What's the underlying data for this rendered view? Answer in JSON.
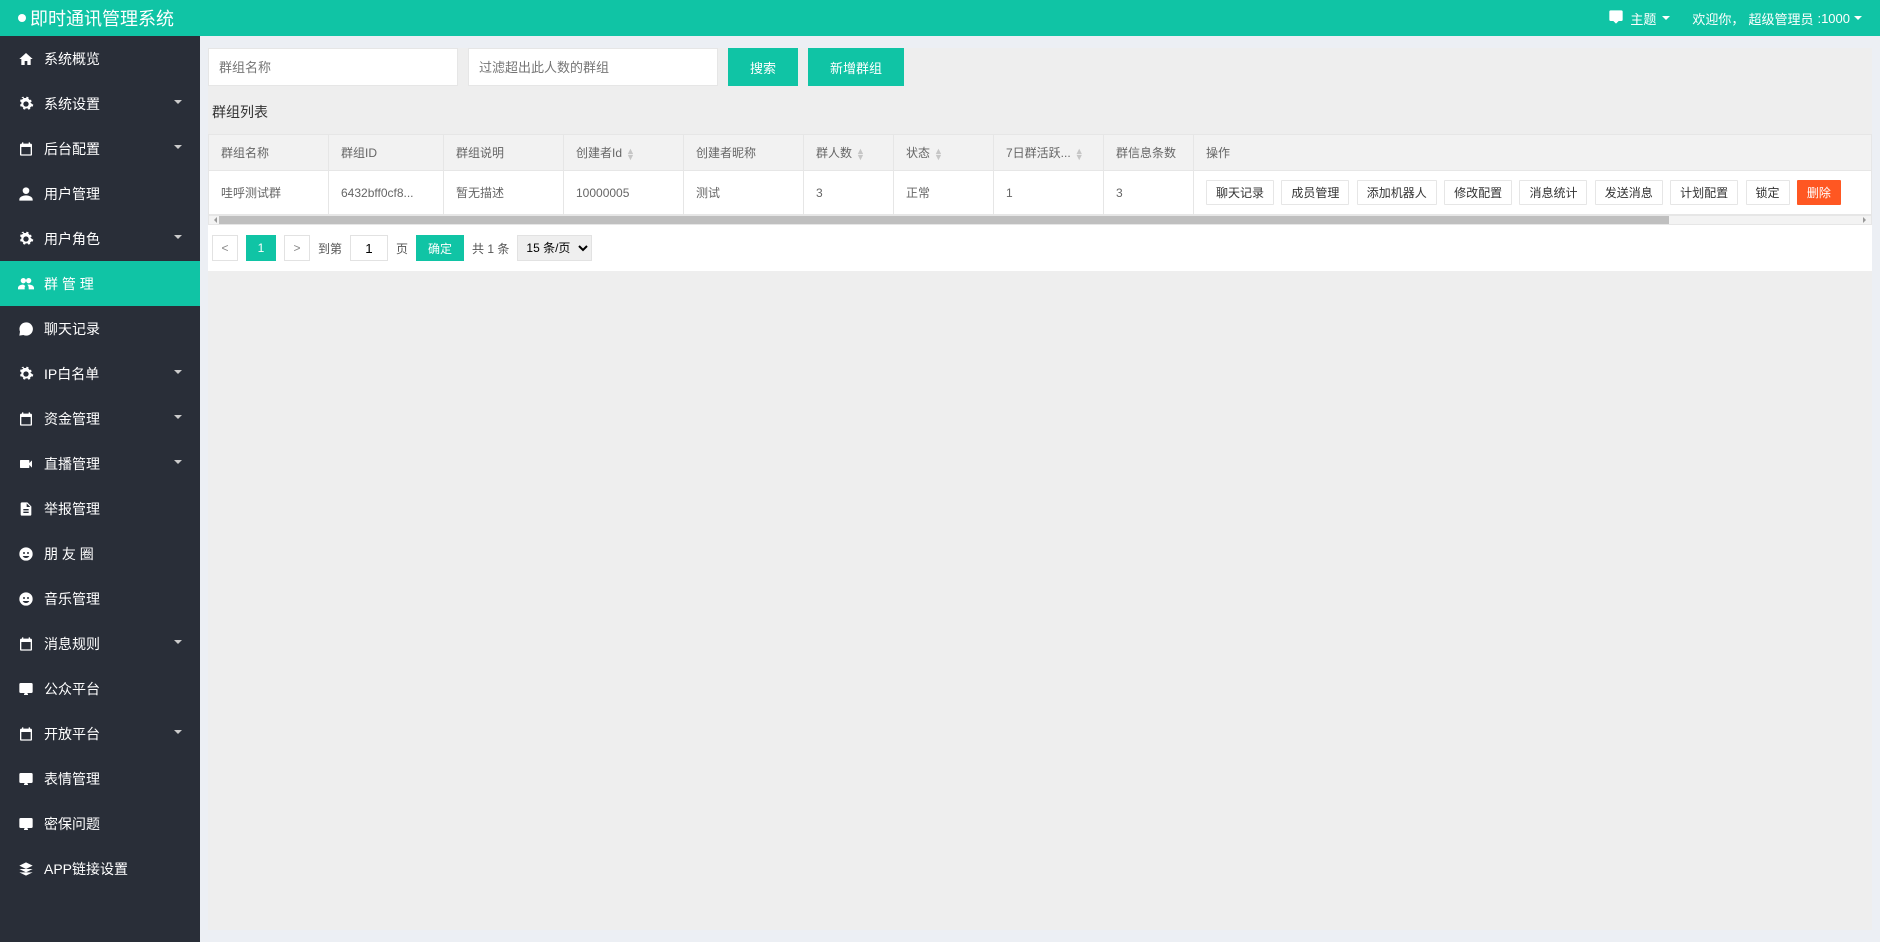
{
  "header": {
    "title": "即时通讯管理系统",
    "theme_label": "主题",
    "welcome_prefix": "欢迎你，",
    "user_role": "超级管理员",
    "user_id": ":1000"
  },
  "sidebar": {
    "items": [
      {
        "icon": "home",
        "label": "系统概览",
        "expandable": false,
        "active": false
      },
      {
        "icon": "gear",
        "label": "系统设置",
        "expandable": true,
        "active": false
      },
      {
        "icon": "calendar",
        "label": "后台配置",
        "expandable": true,
        "active": false
      },
      {
        "icon": "user",
        "label": "用户管理",
        "expandable": false,
        "active": false
      },
      {
        "icon": "gear",
        "label": "用户角色",
        "expandable": true,
        "active": false
      },
      {
        "icon": "users",
        "label": "群 管 理",
        "expandable": false,
        "active": true
      },
      {
        "icon": "chat",
        "label": "聊天记录",
        "expandable": false,
        "active": false
      },
      {
        "icon": "gear",
        "label": "IP白名单",
        "expandable": true,
        "active": false
      },
      {
        "icon": "calendar",
        "label": "资金管理",
        "expandable": true,
        "active": false
      },
      {
        "icon": "video",
        "label": "直播管理",
        "expandable": true,
        "active": false
      },
      {
        "icon": "doc",
        "label": "举报管理",
        "expandable": false,
        "active": false
      },
      {
        "icon": "smile",
        "label": "朋 友 圈",
        "expandable": false,
        "active": false
      },
      {
        "icon": "smile",
        "label": "音乐管理",
        "expandable": false,
        "active": false
      },
      {
        "icon": "calendar",
        "label": "消息规则",
        "expandable": true,
        "active": false
      },
      {
        "icon": "monitor",
        "label": "公众平台",
        "expandable": false,
        "active": false
      },
      {
        "icon": "calendar",
        "label": "开放平台",
        "expandable": true,
        "active": false
      },
      {
        "icon": "monitor",
        "label": "表情管理",
        "expandable": false,
        "active": false
      },
      {
        "icon": "monitor",
        "label": "密保问题",
        "expandable": false,
        "active": false
      },
      {
        "icon": "layers",
        "label": "APP链接设置",
        "expandable": false,
        "active": false
      }
    ]
  },
  "toolbar": {
    "name_placeholder": "群组名称",
    "filter_placeholder": "过滤超出此人数的群组",
    "search_label": "搜索",
    "add_label": "新增群组"
  },
  "section_title": "群组列表",
  "table": {
    "headers": {
      "name": "群组名称",
      "id": "群组ID",
      "desc": "群组说明",
      "creator_id": "创建者Id",
      "creator_nick": "创建者昵称",
      "count": "群人数",
      "status": "状态",
      "activity": "7日群活跃...",
      "msg_count": "群信息条数",
      "ops": "操作"
    },
    "rows": [
      {
        "name": "哇呼测试群",
        "id": "6432bff0cf8...",
        "desc": "暂无描述",
        "creator_id": "10000005",
        "creator_nick": "测试",
        "count": "3",
        "status": "正常",
        "activity": "1",
        "msg_count": "3"
      }
    ],
    "actions": {
      "chat_log": "聊天记录",
      "member_mgmt": "成员管理",
      "add_bot": "添加机器人",
      "edit_config": "修改配置",
      "msg_stats": "消息统计",
      "send_msg": "发送消息",
      "plan_config": "计划配置",
      "lock": "锁定",
      "delete": "删除"
    }
  },
  "pager": {
    "current_page": "1",
    "goto_prefix": "到第",
    "goto_value": "1",
    "goto_suffix": "页",
    "confirm": "确定",
    "total": "共 1 条",
    "page_size": "15 条/页"
  }
}
